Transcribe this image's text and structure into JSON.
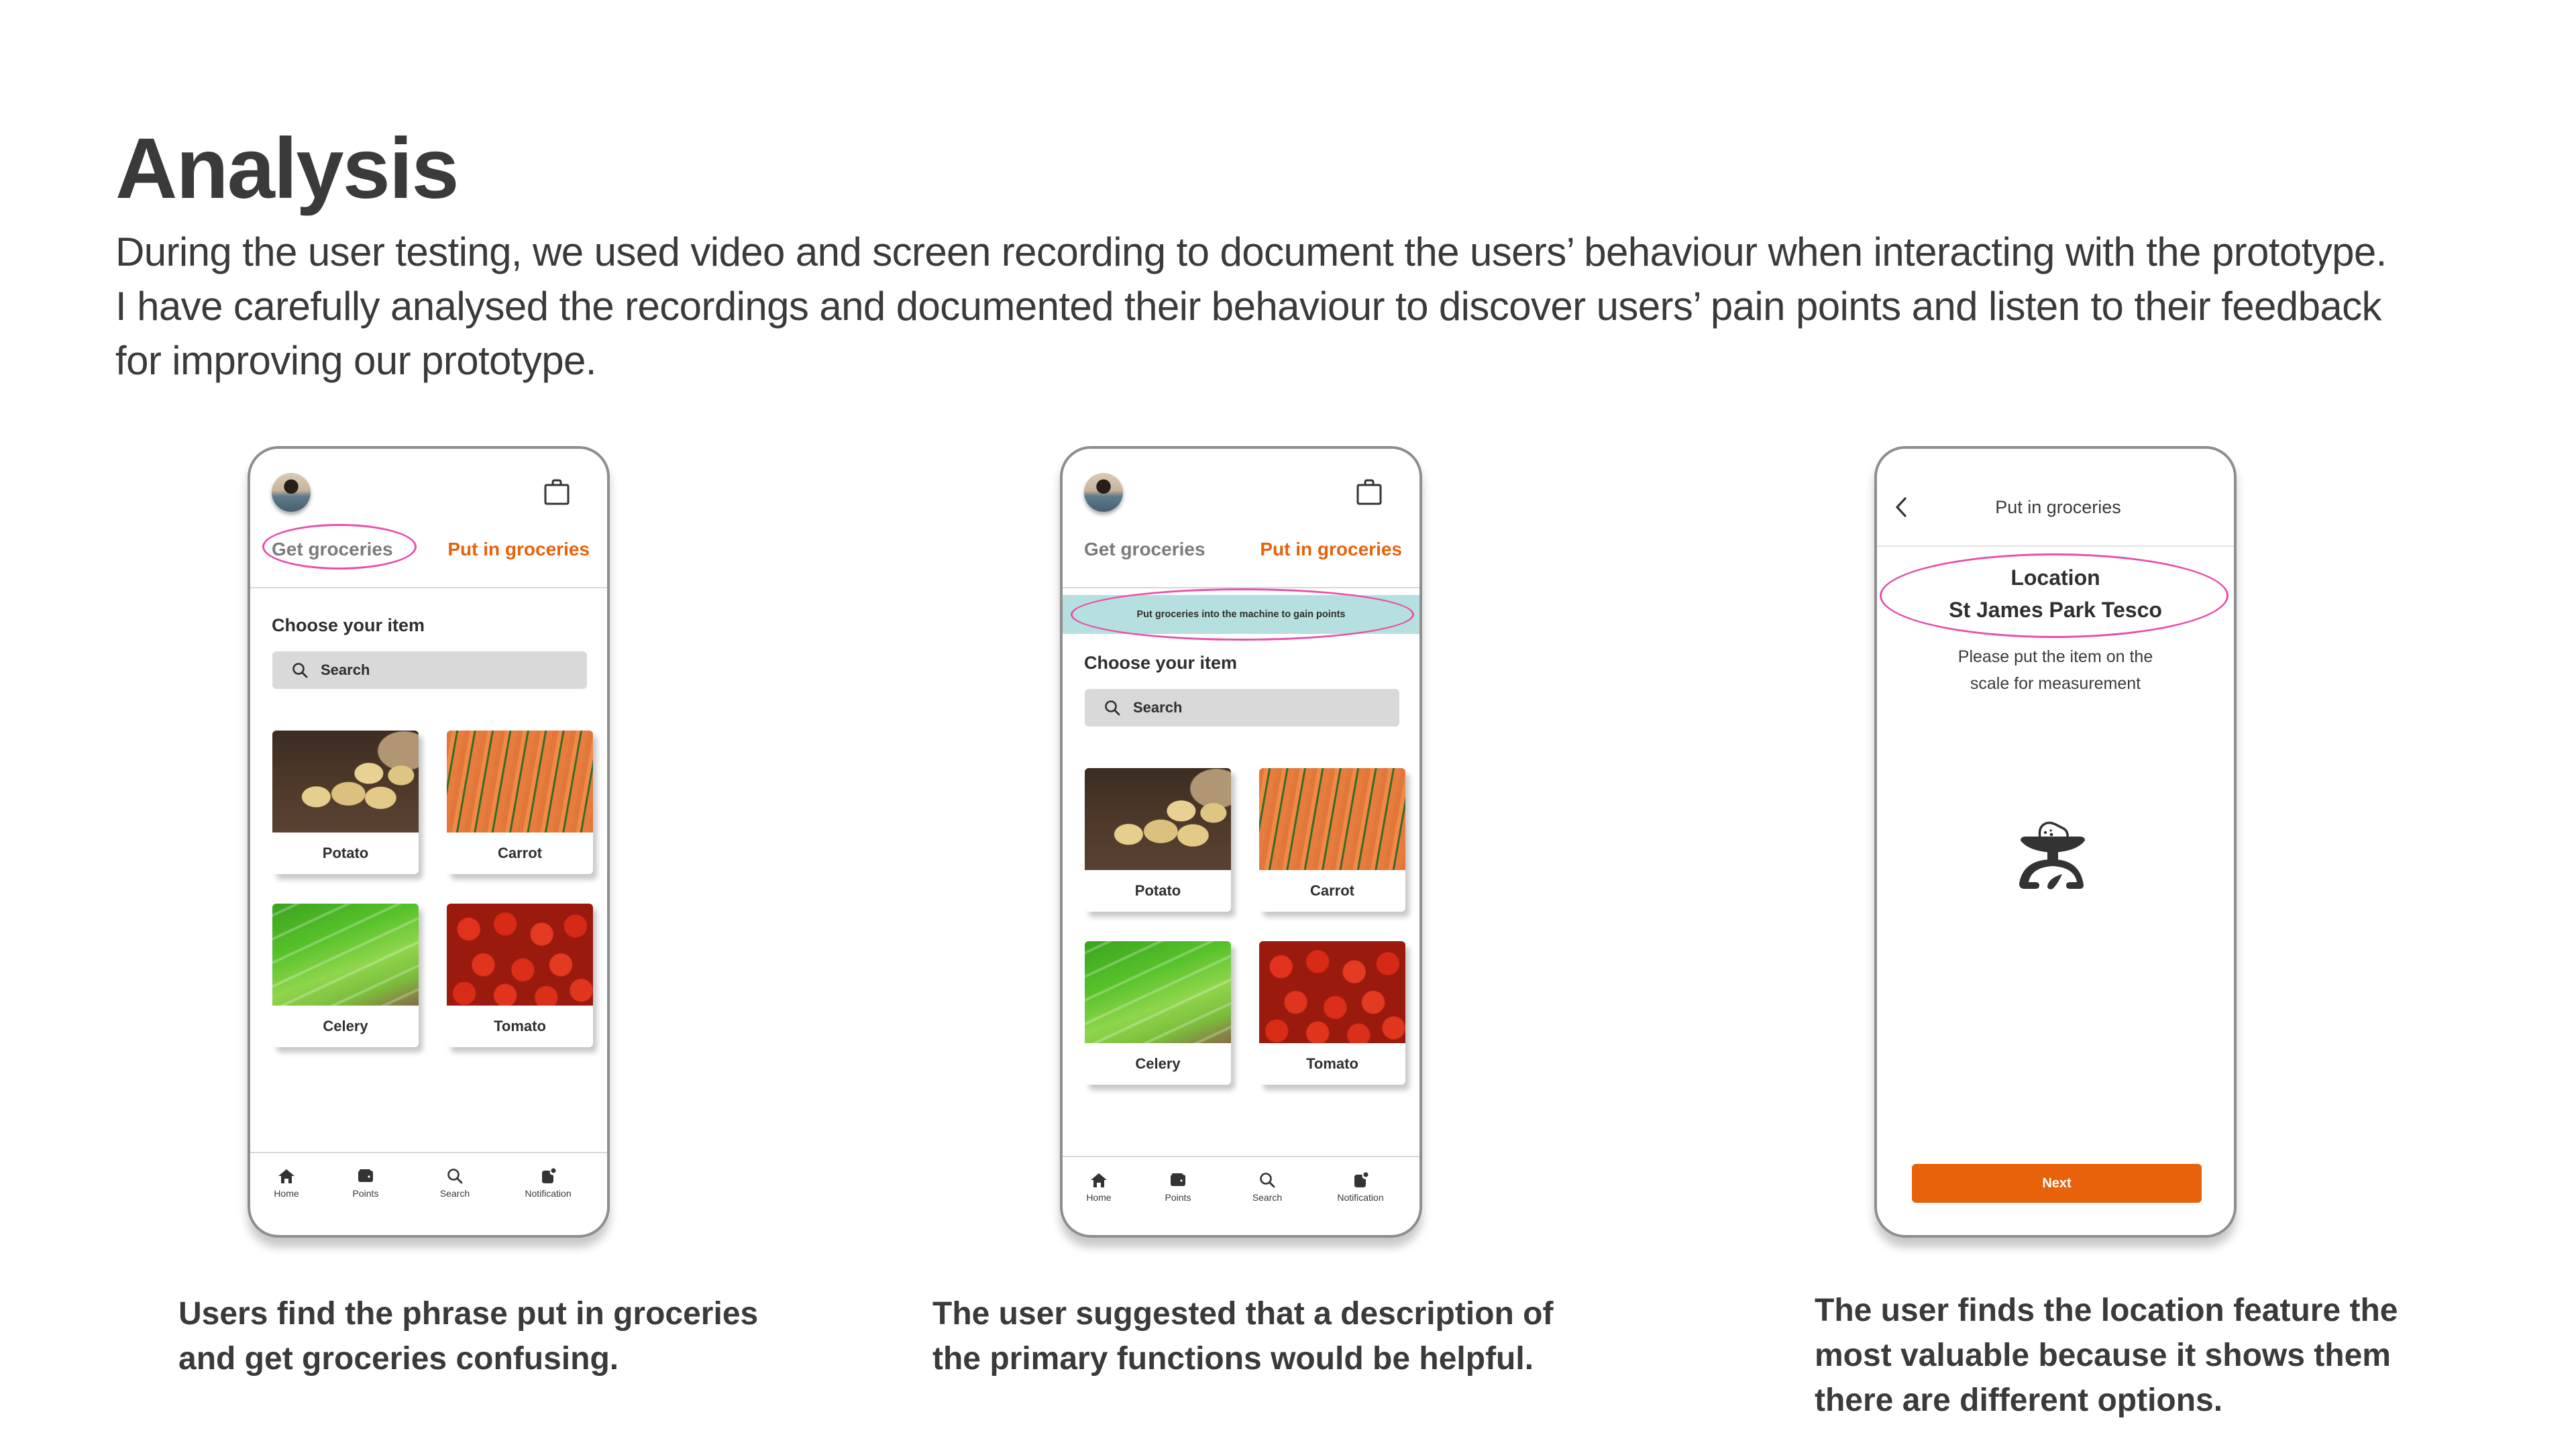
{
  "page": {
    "title": "Analysis",
    "intro_lines": [
      "During the user testing, we used video and screen recording to document the users’ behaviour when interacting with the prototype.",
      "I have carefully analysed the recordings and documented their behaviour to discover users’ pain points and listen to their feedback",
      "for improving our prototype."
    ]
  },
  "colors": {
    "accent_orange": "#e8620c",
    "highlight_pink": "#e94fa8",
    "banner_teal": "#b5e0df",
    "text_dark": "#3a3a3a"
  },
  "icons": {
    "avatar": "avatar",
    "bag": "shopping-bag-icon",
    "search": "search-icon",
    "home": "home-icon",
    "points": "wallet-icon",
    "notification": "notification-icon",
    "back": "chevron-left-icon",
    "scale": "kitchen-scale-icon"
  },
  "phones": [
    {
      "tabs": {
        "get": "Get groceries",
        "put": "Put in groceries"
      },
      "highlight": "Get groceries",
      "choose_label": "Choose your item",
      "search_placeholder": "Search",
      "items": [
        "Potato",
        "Carrot",
        "Celery",
        "Tomato"
      ],
      "nav": [
        "Home",
        "Points",
        "Search",
        "Notification"
      ]
    },
    {
      "tabs": {
        "get": "Get groceries",
        "put": "Put in groceries"
      },
      "banner": "Put groceries into the machine to gain points",
      "choose_label": "Choose your item",
      "search_placeholder": "Search",
      "items": [
        "Potato",
        "Carrot",
        "Celery",
        "Tomato"
      ],
      "nav": [
        "Home",
        "Points",
        "Search",
        "Notification"
      ]
    },
    {
      "header_title": "Put in groceries",
      "location_label": "Location",
      "location_name": "St James Park Tesco",
      "instruction_lines": [
        "Please put the item on the",
        "scale for measurement"
      ],
      "next_label": "Next"
    }
  ],
  "captions": [
    [
      "Users find the phrase put in groceries",
      "and get groceries confusing."
    ],
    [
      "The user suggested that a description of",
      "the primary functions would be helpful."
    ],
    [
      "The user finds the location feature the",
      "most valuable because it shows them",
      "there are different options."
    ]
  ]
}
